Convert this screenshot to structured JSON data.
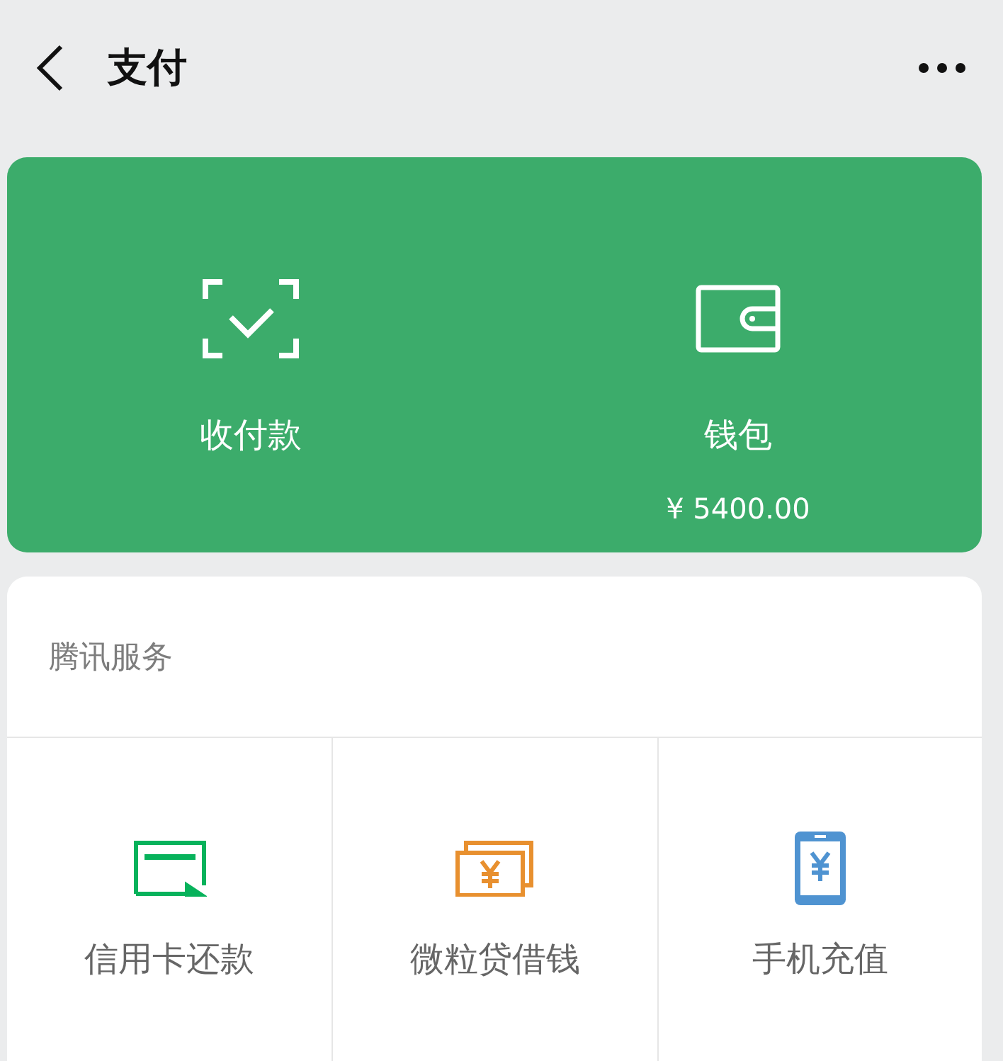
{
  "header": {
    "title": "支付"
  },
  "wallet_panel": {
    "items": [
      {
        "kind": "scan",
        "label": "收付款"
      },
      {
        "kind": "wallet",
        "label": "钱包",
        "balance": "¥ 5400.00"
      }
    ]
  },
  "services": {
    "title": "腾讯服务",
    "items": [
      {
        "kind": "card",
        "label": "信用卡还款",
        "color": "#07b25b"
      },
      {
        "kind": "cash",
        "label": "微粒贷借钱",
        "color": "#e8902f"
      },
      {
        "kind": "phone",
        "label": "手机充值",
        "color": "#4f93d1"
      }
    ]
  }
}
